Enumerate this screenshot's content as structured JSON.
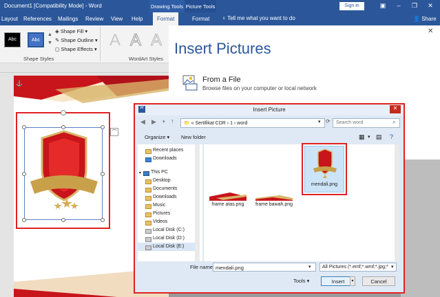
{
  "window": {
    "document_title": "Document1 [Compatibility Mode] - Word",
    "context_drawing": "Drawing Tools",
    "context_picture": "Picture Tools",
    "signin": "Sign in",
    "share": "Share"
  },
  "tabs": [
    "Layout",
    "References",
    "Mailings",
    "Review",
    "View",
    "Help",
    "Format",
    "Format"
  ],
  "tell_me": "Tell me what you want to do",
  "ribbon": {
    "style_swatches": [
      "Abc",
      "Abc"
    ],
    "shape_fill": "Shape Fill",
    "shape_outline": "Shape Outline",
    "shape_effects": "Shape Effects",
    "shape_styles_label": "Shape Styles",
    "wordart_letters": [
      "A",
      "A",
      "A"
    ],
    "wordart_label": "WordArt Styles"
  },
  "insert_pictures": {
    "title": "Insert Pictures",
    "from_file": "From a File",
    "browse": "Browse files on your computer or local network"
  },
  "dialog": {
    "title": "Insert Picture",
    "address": "« Sertifikat CDR › 1 › word",
    "search_placeholder": "Search word",
    "organize": "Organize ▾",
    "new_folder": "New folder",
    "nav_items": [
      "Recent places",
      "Downloads",
      "This PC",
      "Desktop",
      "Documents",
      "Downloads",
      "Music",
      "Pictures",
      "Videos",
      "Local Disk (C:)",
      "Local Disk (D:)",
      "Local Disk (E:)"
    ],
    "files": [
      "frame atas.png",
      "frame bawah.png",
      "mendali.png"
    ],
    "file_name_label": "File name:",
    "file_name_value": "mendali.png",
    "file_type": "All Pictures (*.emf;*.wmf;*.jpg;*",
    "tools": "Tools",
    "insert": "Insert",
    "cancel": "Cancel"
  },
  "colors": {
    "brand": "#2b579a",
    "highlight": "#e02020",
    "shield": "#c8141b",
    "gold": "#c9a04a"
  }
}
